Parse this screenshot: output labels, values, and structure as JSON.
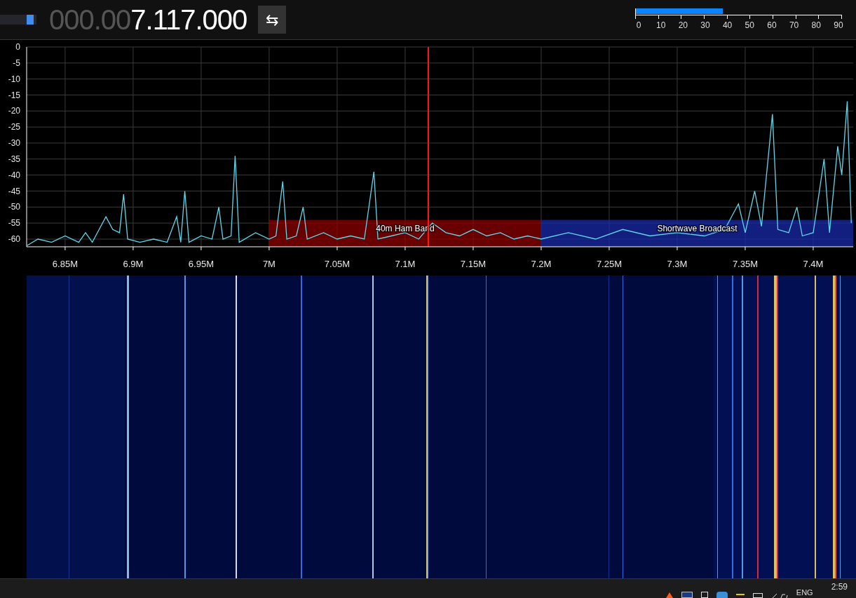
{
  "toolbar": {
    "volume": {
      "level": 0.9
    },
    "frequency": {
      "leading": "000.00",
      "value": "7.117.000"
    },
    "swap_button": {
      "label": "⇆"
    },
    "snr_meter": {
      "level": 0.42,
      "ticks": [
        "0",
        "10",
        "20",
        "30",
        "40",
        "50",
        "60",
        "70",
        "80",
        "90"
      ]
    }
  },
  "spectrum": {
    "chart_data": {
      "type": "line",
      "xlim": [
        6.8217,
        7.4294
      ],
      "ylim": [
        -62.4,
        0
      ],
      "yticks": [
        0,
        -5,
        -10,
        -15,
        -20,
        -25,
        -30,
        -35,
        -40,
        -45,
        -50,
        -55,
        -60
      ],
      "xticks": [
        {
          "value": 6.85,
          "label": "6.85M"
        },
        {
          "value": 6.9,
          "label": "6.9M"
        },
        {
          "value": 6.95,
          "label": "6.95M"
        },
        {
          "value": 7.0,
          "label": "7M"
        },
        {
          "value": 7.05,
          "label": "7.05M"
        },
        {
          "value": 7.1,
          "label": "7.1M"
        },
        {
          "value": 7.15,
          "label": "7.15M"
        },
        {
          "value": 7.2,
          "label": "7.2M"
        },
        {
          "value": 7.25,
          "label": "7.25M"
        },
        {
          "value": 7.3,
          "label": "7.3M"
        },
        {
          "value": 7.35,
          "label": "7.35M"
        },
        {
          "value": 7.4,
          "label": "7.4M"
        }
      ],
      "x": [
        6.822,
        6.83,
        6.84,
        6.85,
        6.86,
        6.865,
        6.87,
        6.875,
        6.88,
        6.885,
        6.89,
        6.893,
        6.896,
        6.905,
        6.915,
        6.925,
        6.932,
        6.935,
        6.938,
        6.941,
        6.95,
        6.958,
        6.963,
        6.966,
        6.972,
        6.975,
        6.978,
        6.99,
        7.0,
        7.005,
        7.01,
        7.013,
        7.02,
        7.025,
        7.028,
        7.04,
        7.05,
        7.06,
        7.07,
        7.077,
        7.08,
        7.09,
        7.1,
        7.11,
        7.12,
        7.13,
        7.14,
        7.15,
        7.16,
        7.17,
        7.18,
        7.19,
        7.2,
        7.22,
        7.24,
        7.26,
        7.28,
        7.3,
        7.32,
        7.335,
        7.345,
        7.35,
        7.357,
        7.362,
        7.37,
        7.374,
        7.382,
        7.388,
        7.392,
        7.4,
        7.408,
        7.412,
        7.418,
        7.421,
        7.425,
        7.428
      ],
      "series": [
        {
          "color": "#5fd7ea",
          "values": [
            -62,
            -60,
            -61,
            -59,
            -61,
            -58,
            -61,
            -57,
            -53,
            -57,
            -58,
            -46,
            -60,
            -61,
            -60,
            -61,
            -53,
            -61,
            -45,
            -61,
            -59,
            -60,
            -50,
            -60,
            -59,
            -34,
            -61,
            -58,
            -60,
            -59,
            -42,
            -60,
            -59,
            -50,
            -60,
            -58,
            -60,
            -59,
            -60,
            -39,
            -60,
            -59,
            -58,
            -60,
            -55,
            -58,
            -59,
            -57,
            -59,
            -58,
            -60,
            -59,
            -60,
            -58,
            -60,
            -57,
            -59,
            -58,
            -59,
            -57,
            -49,
            -58,
            -45,
            -56,
            -21,
            -57,
            -58,
            -50,
            -59,
            -58,
            -35,
            -58,
            -31,
            -40,
            -17,
            -55
          ]
        }
      ],
      "grid": true,
      "bands": [
        {
          "axis": "x",
          "from": 7.0,
          "to": 7.2,
          "label": "40m Ham Band",
          "color": "#8b0000"
        },
        {
          "axis": "x",
          "from": 7.2,
          "to": 7.4294,
          "label": "Shortwave Broadcast",
          "color": "#1a2aa8"
        }
      ],
      "ref_lines": [
        {
          "axis": "x",
          "value": 7.117,
          "color": "#ff1a1a"
        }
      ]
    }
  },
  "taskbar": {
    "language": "ENG",
    "clock": "2:59"
  }
}
